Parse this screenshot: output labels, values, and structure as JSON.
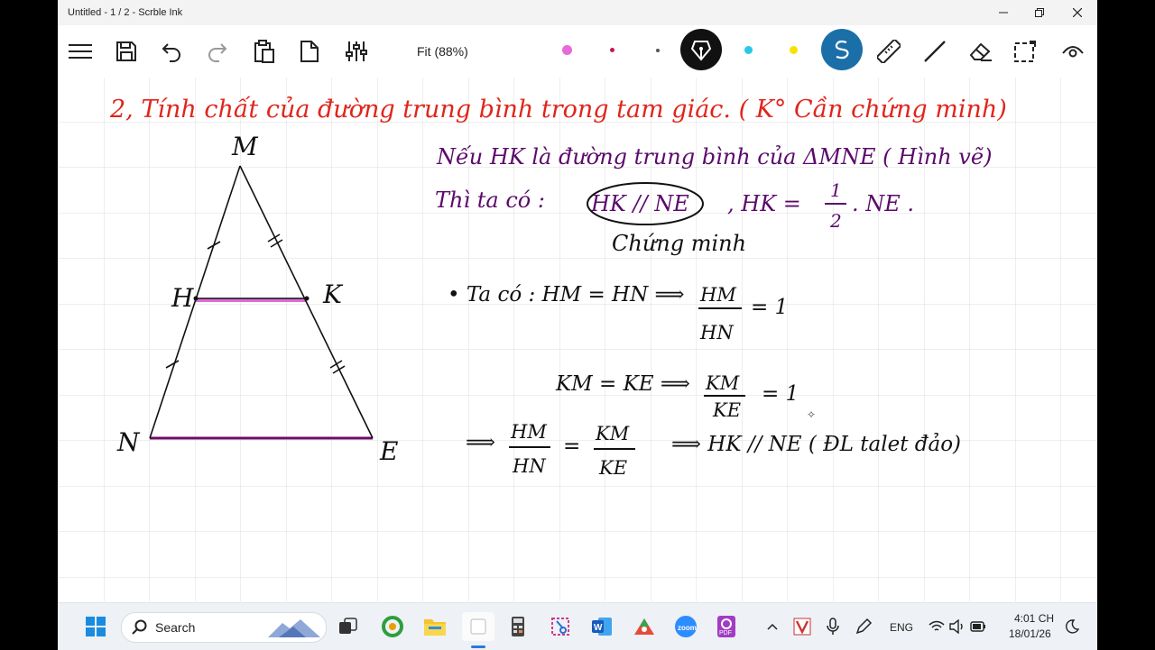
{
  "window": {
    "title": "Untitled - 1 / 2 - Scrble Ink"
  },
  "toolbar": {
    "zoom_label": "Fit (88%)",
    "pen_colors": [
      "#e86ad8",
      "#c2185b",
      "#555555",
      "#28c8e6",
      "#f5e400"
    ],
    "active_tool_color": "#1b6fa8"
  },
  "note": {
    "heading": "2, Tính chất của đường trung bình trong tam giác. ( K° Cần chứng minh)",
    "line1": "Nếu HK là đường trung bình của ΔMNE ( Hình vẽ)",
    "line2_prefix": "Thì ta có :",
    "circled": "HK // NE",
    "relation_lhs": ", HK =",
    "frac_num": "1",
    "frac_den": "2",
    "relation_rhs": ". NE .",
    "proof_title": "Chứng minh",
    "step1": "• Ta có : HM = HN  ⟹",
    "step1_num": "HM",
    "step1_den": "HN",
    "step1_result": "= 1",
    "step2": "KM = KE ⟹",
    "step2_num": "KM",
    "step2_den": "KE",
    "step2_result": "= 1",
    "step3_arrow": "⟹",
    "step3_n1": "HM",
    "step3_d1": "HN",
    "step3_eq": "=",
    "step3_n2": "KM",
    "step3_d2": "KE",
    "step3_conclusion": "⟹   HK // NE ( ĐL talet đảo)"
  },
  "figure": {
    "vertex_M": "M",
    "vertex_H": "H",
    "vertex_K": "K",
    "vertex_N": "N",
    "vertex_E": "E",
    "highlight_color": "#e06ad8"
  },
  "taskbar": {
    "search_placeholder": "Search",
    "language": "ENG",
    "time": "4:01 CH",
    "date": "18/01/26"
  }
}
